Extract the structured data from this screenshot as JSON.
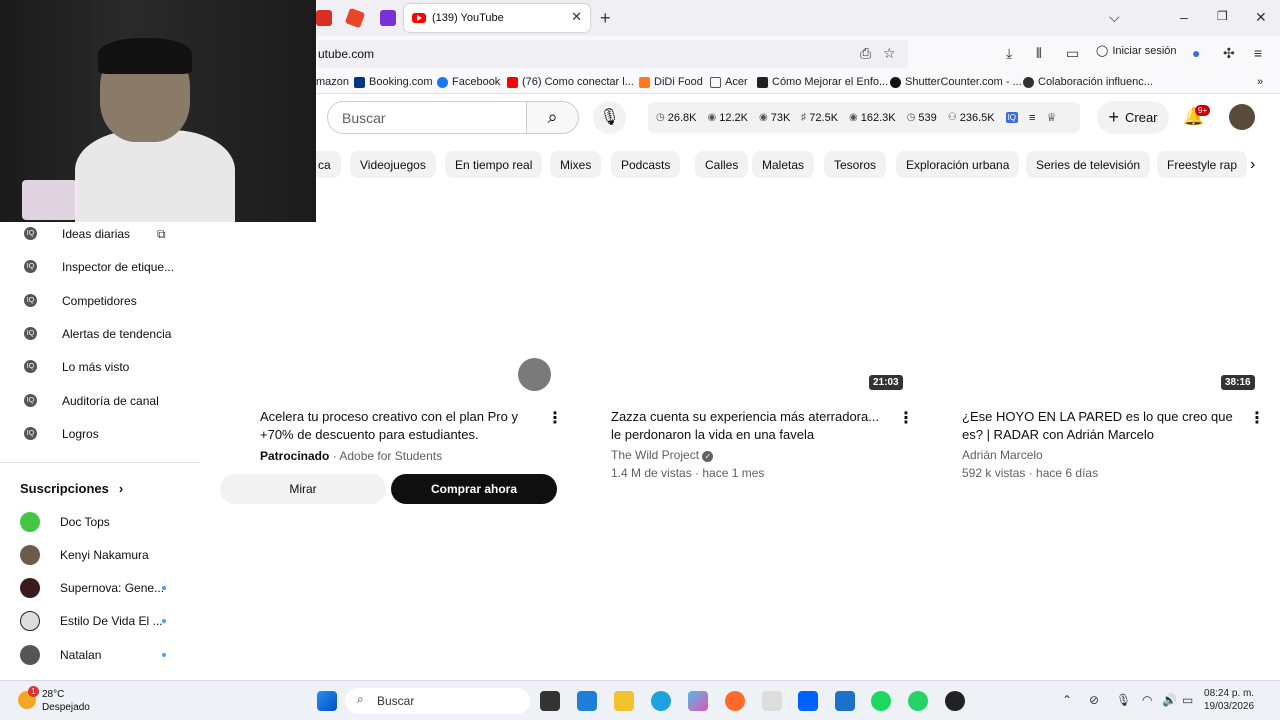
{
  "browser": {
    "tab_title": "(139) YouTube",
    "url": "utube.com",
    "sign_in": "Iniciar sesión",
    "bookmarks": [
      "mazon",
      "Booking.com",
      "Facebook",
      "(76) Como conectar l...",
      "DiDi Food",
      "Acer",
      "Cómo Mejorar el Enfo...",
      "ShutterCounter.com - ...",
      "Colaboración influenc..."
    ]
  },
  "youtube": {
    "search_placeholder": "Buscar",
    "stats": [
      {
        "icon": "clock-icon",
        "value": "26.8K"
      },
      {
        "icon": "eye-icon",
        "value": "12.2K"
      },
      {
        "icon": "eye-icon",
        "value": "73K"
      },
      {
        "icon": "like-icon",
        "value": "72.5K"
      },
      {
        "icon": "eye-icon",
        "value": "162.3K"
      },
      {
        "icon": "clock-icon",
        "value": "539"
      },
      {
        "icon": "person-icon",
        "value": "236.5K"
      }
    ],
    "create_label": "Crear",
    "notif_count": "9+",
    "chips": [
      "ca",
      "Videojuegos",
      "En tiempo real",
      "Mixes",
      "Podcasts",
      "Calles",
      "Maletas",
      "Tesoros",
      "Exploración urbana",
      "Series de televisión",
      "Freestyle rap"
    ]
  },
  "sidebar": {
    "items": [
      "Ideas diarias",
      "Inspector de etique...",
      "Competidores",
      "Alertas de tendencia",
      "Lo más visto",
      "Auditoría de canal",
      "Logros"
    ],
    "subs_title": "Suscripciones",
    "subs": [
      {
        "name": "Doc Tops",
        "color": "#43c743",
        "dot": false
      },
      {
        "name": "Kenyi Nakamura",
        "color": "#6b5b4b",
        "dot": false
      },
      {
        "name": "Supernova: Gene...",
        "color": "#3a1a1a",
        "dot": true
      },
      {
        "name": "Estilo De Vida El ...",
        "color": "#222222",
        "dot": true
      },
      {
        "name": "Natalan",
        "color": "#555555",
        "dot": true
      }
    ]
  },
  "videos": {
    "ad": {
      "title1": "Acelera tu proceso creativo con el plan Pro y",
      "title2": "+70% de descuento para estudiantes.",
      "sponsored": "Patrocinado",
      "advertiser": "· Adobe for Students",
      "watch": "Mirar",
      "buy": "Comprar ahora"
    },
    "v1": {
      "duration": "21:03",
      "title1": "Zazza cuenta su experiencia más aterradora...",
      "title2": "le perdonaron la vida en una favela",
      "channel": "The Wild Project",
      "meta": "1.4 M de vistas · hace 1 mes"
    },
    "v2": {
      "duration": "38:16",
      "title1": "¿Ese HOYO EN LA PARED es lo que creo que",
      "title2": "es? | RADAR con Adrián Marcelo",
      "channel": "Adrián Marcelo",
      "meta": "592 k vistas · hace 6 días"
    }
  },
  "taskbar": {
    "temp": "28°C",
    "weather": "Despejado",
    "weather_badge": "1",
    "search": "Buscar",
    "time": "08:24 p. m.",
    "date": "19/03/2026"
  }
}
